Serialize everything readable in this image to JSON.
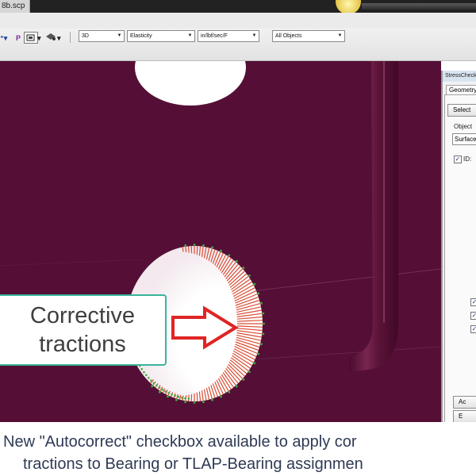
{
  "window": {
    "title": "8b.scp"
  },
  "toolbar": {
    "icons": [
      "p-arrow-icon",
      "p-icon",
      "select-mode-icon",
      "view-tool-icon"
    ],
    "p_label": "P",
    "view_combo": "3D",
    "analysis_combo": "Elasticity",
    "units_combo": "in/lbf/sec/F",
    "filter_combo": "All Objects"
  },
  "viewport": {
    "background_color": "#550f36",
    "traction_color": "#d8442a",
    "secondary_color": "#3fae3f"
  },
  "callout": {
    "line1": "Corrective",
    "line2": "tractions"
  },
  "panel": {
    "title": "StressCheck",
    "tab": "Geometry",
    "select_button": "Select",
    "object_label": "Object",
    "object_value": "Surface",
    "id_label": "ID:",
    "id_checked": true,
    "bottom_checks": [
      true,
      true,
      true
    ],
    "action_button_1": "Ac",
    "action_button_2": "E"
  },
  "caption": {
    "line1": "New \"Autocorrect\" checkbox available to apply cor",
    "line2": "tractions to Bearing or TLAP-Bearing assignmen"
  }
}
